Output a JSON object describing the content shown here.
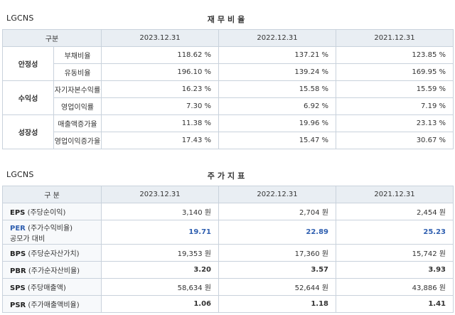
{
  "financial": {
    "company": "LGCNS",
    "title": "재무비율",
    "header": [
      "구분",
      "2023.12.31",
      "2022.12.31",
      "2021.12.31"
    ],
    "groups": [
      {
        "name": "안정성",
        "rows": [
          {
            "label": "부채비율",
            "values": [
              "118.62 %",
              "137.21 %",
              "123.85 %"
            ]
          },
          {
            "label": "유동비율",
            "values": [
              "196.10 %",
              "139.24 %",
              "169.95 %"
            ]
          }
        ]
      },
      {
        "name": "수익성",
        "rows": [
          {
            "label": "자기자본수익률",
            "values": [
              "16.23 %",
              "15.58 %",
              "15.59 %"
            ]
          },
          {
            "label": "영업이익률",
            "values": [
              "7.30 %",
              "6.92 %",
              "7.19 %"
            ]
          }
        ]
      },
      {
        "name": "성장성",
        "rows": [
          {
            "label": "매출액증가율",
            "values": [
              "11.38 %",
              "19.96 %",
              "23.13 %"
            ]
          },
          {
            "label": "영업이익증가율",
            "values": [
              "17.43 %",
              "15.47 %",
              "30.67 %"
            ]
          }
        ]
      }
    ]
  },
  "stock": {
    "company": "LGCNS",
    "title": "주가지표",
    "header": [
      "구 분",
      "2023.12.31",
      "2022.12.31",
      "2021.12.31"
    ],
    "rows": [
      {
        "abbr": "EPS",
        "desc": "(주당순이익)",
        "sub": "",
        "values": [
          "3,140 원",
          "2,704 원",
          "2,454 원"
        ]
      },
      {
        "abbr": "PER",
        "desc": "(주가수익비율)",
        "sub": "공모가 대비",
        "values": [
          "19.71",
          "22.89",
          "25.23"
        ]
      },
      {
        "abbr": "BPS",
        "desc": "(주당순자산가치)",
        "sub": "",
        "values": [
          "19,353 원",
          "17,360 원",
          "15,742 원"
        ]
      },
      {
        "abbr": "PBR",
        "desc": "(주가순자산비율)",
        "sub": "",
        "values": [
          "3.20",
          "3.57",
          "3.93"
        ]
      },
      {
        "abbr": "SPS",
        "desc": "(주당매출액)",
        "sub": "",
        "values": [
          "58,634 원",
          "52,644 원",
          "43,886 원"
        ]
      },
      {
        "abbr": "PSR",
        "desc": "(주가매출액비율)",
        "sub": "",
        "values": [
          "1.06",
          "1.18",
          "1.41"
        ]
      }
    ]
  }
}
